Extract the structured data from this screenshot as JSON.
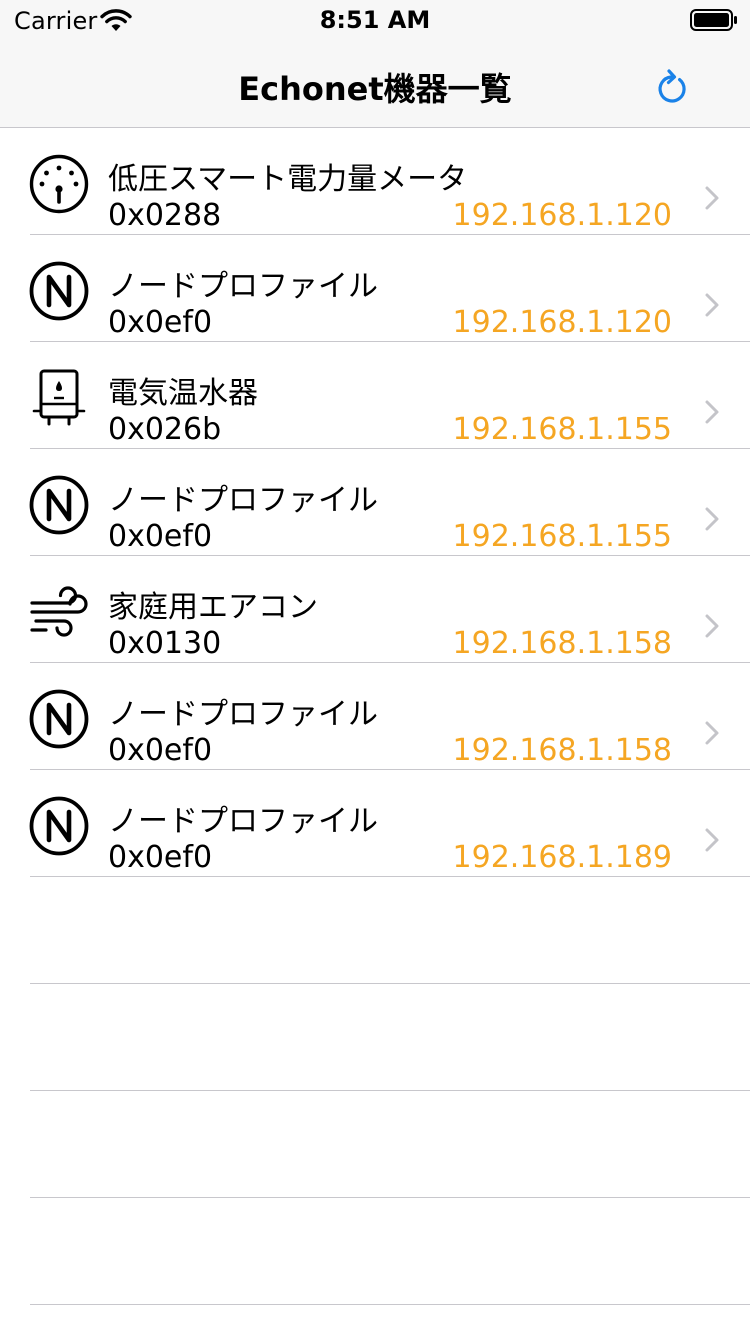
{
  "status_bar": {
    "carrier": "Carrier",
    "time": "8:51 AM"
  },
  "nav": {
    "title": "Echonet機器一覧",
    "refresh_icon": "refresh-icon"
  },
  "colors": {
    "ip_accent": "#f5a623",
    "tint": "#1a82e8"
  },
  "devices": [
    {
      "name": "低圧スマート電力量メータ",
      "code": "0x0288",
      "ip": "192.168.1.120",
      "icon": "meter-gauge-icon"
    },
    {
      "name": "ノードプロファイル",
      "code": "0x0ef0",
      "ip": "192.168.1.120",
      "icon": "node-profile-icon"
    },
    {
      "name": "電気温水器",
      "code": "0x026b",
      "ip": "192.168.1.155",
      "icon": "water-heater-icon"
    },
    {
      "name": "ノードプロファイル",
      "code": "0x0ef0",
      "ip": "192.168.1.155",
      "icon": "node-profile-icon"
    },
    {
      "name": "家庭用エアコン",
      "code": "0x0130",
      "ip": "192.168.1.158",
      "icon": "wind-icon"
    },
    {
      "name": "ノードプロファイル",
      "code": "0x0ef0",
      "ip": "192.168.1.158",
      "icon": "node-profile-icon"
    },
    {
      "name": "ノードプロファイル",
      "code": "0x0ef0",
      "ip": "192.168.1.189",
      "icon": "node-profile-icon"
    }
  ]
}
